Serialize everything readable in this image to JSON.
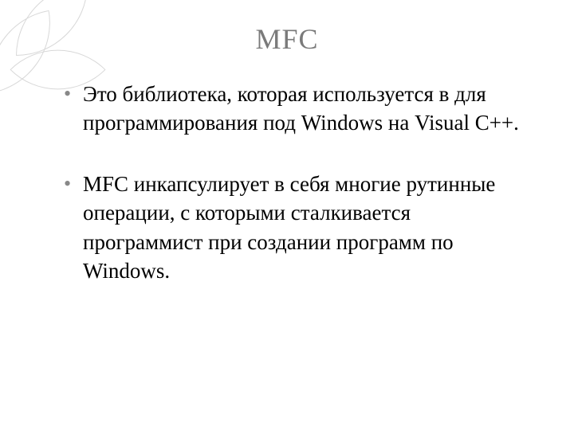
{
  "slide": {
    "title": "MFC",
    "bullets": [
      "Это библиотека, которая используется в для программирования под Windows на Visual C++.",
      "MFC инкапсулирует в себя многие рутинные операции, с которыми сталкивается программист при создании программ по Windows."
    ]
  }
}
